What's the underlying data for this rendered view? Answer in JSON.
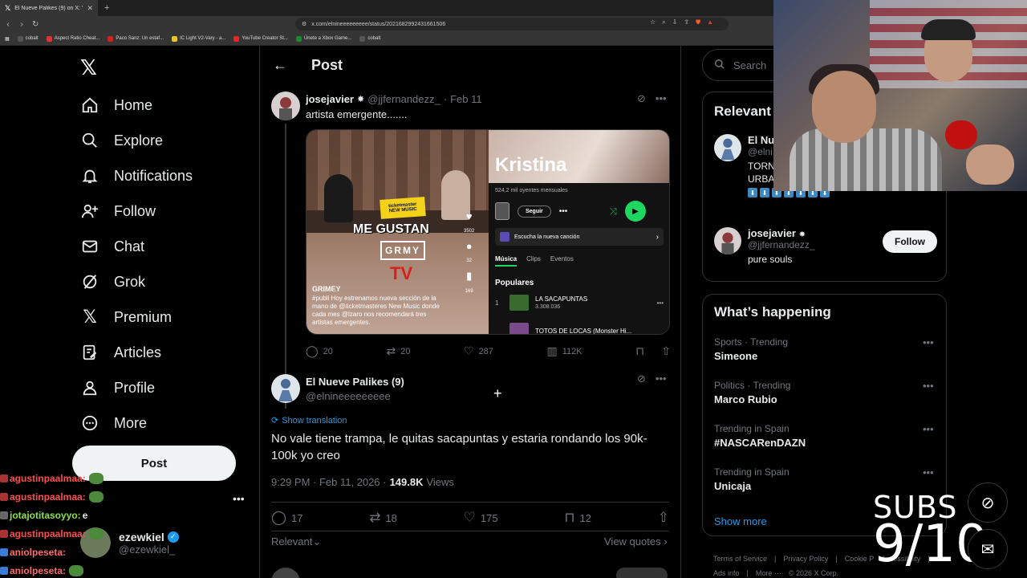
{
  "browser": {
    "tab_title": "El Nueve Palikes (9) on X: \"@jjfe",
    "url": "x.com/elnineeeeeeeee/status/2021682992431661506",
    "bookmarks": [
      "cobalt",
      "Aspect Ratio Cheat...",
      "Paco Sanz: Un estaf...",
      "IC Light V2-Vary - a...",
      "YouTube Creator St...",
      "Únete a Xbox Game...",
      "cobalt"
    ]
  },
  "sidebar": {
    "items": [
      {
        "label": "Home",
        "icon": "home-icon"
      },
      {
        "label": "Explore",
        "icon": "search-icon"
      },
      {
        "label": "Notifications",
        "icon": "bell-icon"
      },
      {
        "label": "Follow",
        "icon": "person-plus-icon"
      },
      {
        "label": "Chat",
        "icon": "envelope-icon"
      },
      {
        "label": "Grok",
        "icon": "grok-icon"
      },
      {
        "label": "Premium",
        "icon": "x-icon"
      },
      {
        "label": "Articles",
        "icon": "article-icon"
      },
      {
        "label": "Profile",
        "icon": "person-icon"
      },
      {
        "label": "More",
        "icon": "more-circle-icon"
      }
    ],
    "post_label": "Post",
    "account": {
      "name": "ezewkiel",
      "handle": "@ezewkiel_"
    }
  },
  "chat": [
    {
      "user": "agustinpaalmaa:",
      "msg": ""
    },
    {
      "user": "agustinpaalmaa:",
      "msg": ""
    },
    {
      "user": "jotajotitasoyyo:",
      "msg": "e"
    },
    {
      "user": "agustinpaalmaa:",
      "msg": ""
    },
    {
      "user": "aniolpeseta:",
      "msg": ""
    },
    {
      "user": "aniolpeseta:",
      "msg": ""
    }
  ],
  "main": {
    "header_title": "Post",
    "quoted": {
      "name": "josejavier",
      "handle": "@jjfernandezz_",
      "sep": "·",
      "date": "Feb 11",
      "text": "artista emergente.......",
      "actions": {
        "replies": "20",
        "reposts": "20",
        "likes": "287",
        "views": "112K"
      },
      "media": {
        "badge_top": "ticketmaster",
        "badge_bottom": "NEW MUSIC",
        "headline": "ME GUSTAN",
        "brand": "GRMY",
        "tv": "TV",
        "likes": "3502",
        "comments": "32",
        "saves": "169",
        "caption_author": "GRIMEY",
        "caption": "#publi Hoy estrenamos nueva sección de la mano de @ticketmasteres New Music donde cada mes @lzaro nos recomendará tres artistas emergentes.",
        "artist": "Kristina",
        "listeners": "524,2 mil oyentes mensuales",
        "follow_label": "Seguir",
        "new_song": "Escucha la nueva canción",
        "tabs": [
          "Música",
          "Clips",
          "Eventos"
        ],
        "popular_label": "Populares",
        "tracks": [
          {
            "num": "1",
            "title": "LA SACAPUNTAS",
            "plays": "3.308.036"
          },
          {
            "num": "",
            "title": "TOTOS DE LOCAS (Monster Hi...",
            "plays": ""
          }
        ]
      }
    },
    "reply": {
      "name": "El Nueve Palikes (9)",
      "handle": "@elnineeeeeeeee",
      "translation": "Show translation",
      "text": "No vale tiene trampa, le quitas sacapuntas y estaria rondando los 90k-100k yo creo",
      "time": "9:29 PM · Feb 11, 2026 ·",
      "views_count": "149.8K",
      "views_label": "Views",
      "actions": {
        "replies": "17",
        "reposts": "18",
        "likes": "175",
        "bookmarks": "12"
      },
      "sort_label": "Relevant",
      "view_quotes": "View quotes"
    }
  },
  "right": {
    "search_placeholder": "Search",
    "relevant": {
      "title": "Relevant",
      "user1": {
        "name": "El Nu",
        "handle": "@elni",
        "bio1": "TORN",
        "bio2": "URBANOS"
      },
      "user2": {
        "name": "josejavier",
        "handle": "@jjfernandezz_",
        "bio": "pure souls",
        "follow_label": "Follow"
      }
    },
    "happening": {
      "title": "What’s happening",
      "trends": [
        {
          "meta": "Sports · Trending",
          "name": "Simeone"
        },
        {
          "meta": "Politics · Trending",
          "name": "Marco Rubio"
        },
        {
          "meta": "Trending in Spain",
          "name": "#NASCARenDAZN"
        },
        {
          "meta": "Trending in Spain",
          "name": "Unicaja"
        }
      ],
      "show_more": "Show more"
    },
    "footer": [
      "Terms of Service",
      "|",
      "Privacy Policy",
      "|",
      "Cookie P",
      "Accessibility",
      "|",
      "Ads info",
      "|",
      "More ···",
      "© 2026 X Corp."
    ]
  },
  "overlay": {
    "subs_label": "SUBS",
    "subs_count": "9/10"
  }
}
